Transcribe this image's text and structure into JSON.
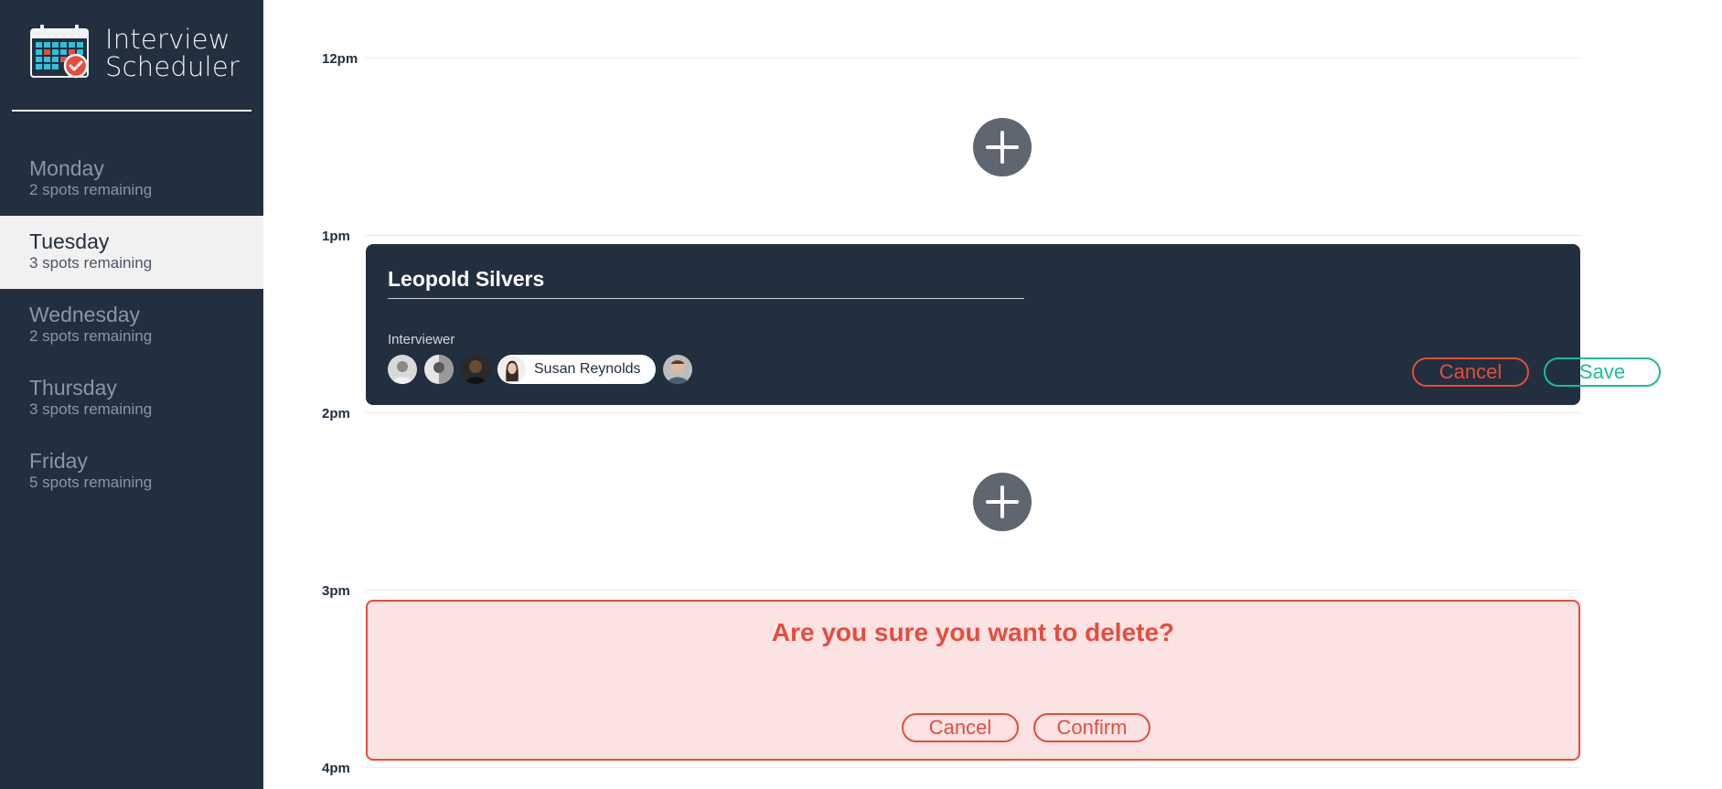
{
  "app": {
    "title_line1": "Interview",
    "title_line2": "Scheduler",
    "logo_icon": "calendar-check-icon"
  },
  "sidebar": {
    "days": [
      {
        "name": "Monday",
        "spots": "2 spots remaining",
        "selected": false
      },
      {
        "name": "Tuesday",
        "spots": "3 spots remaining",
        "selected": true
      },
      {
        "name": "Wednesday",
        "spots": "2 spots remaining",
        "selected": false
      },
      {
        "name": "Thursday",
        "spots": "3 spots remaining",
        "selected": false
      },
      {
        "name": "Friday",
        "spots": "5 spots remaining",
        "selected": false
      }
    ]
  },
  "schedule": {
    "hours": [
      "12pm",
      "1pm",
      "2pm",
      "3pm",
      "4pm"
    ],
    "add_icon": "plus-icon"
  },
  "form": {
    "student_name": "Leopold Silvers",
    "interviewer_label": "Interviewer",
    "selected_interviewer": "Susan Reynolds",
    "cancel_label": "Cancel",
    "save_label": "Save"
  },
  "confirm": {
    "message": "Are you sure you want to delete?",
    "cancel_label": "Cancel",
    "confirm_label": "Confirm"
  },
  "colors": {
    "sidebar_bg": "#222f3e",
    "danger": "#e74c3c",
    "success": "#1abc9c",
    "confirm_bg": "#fce3e3",
    "add_button": "#5e6670"
  }
}
